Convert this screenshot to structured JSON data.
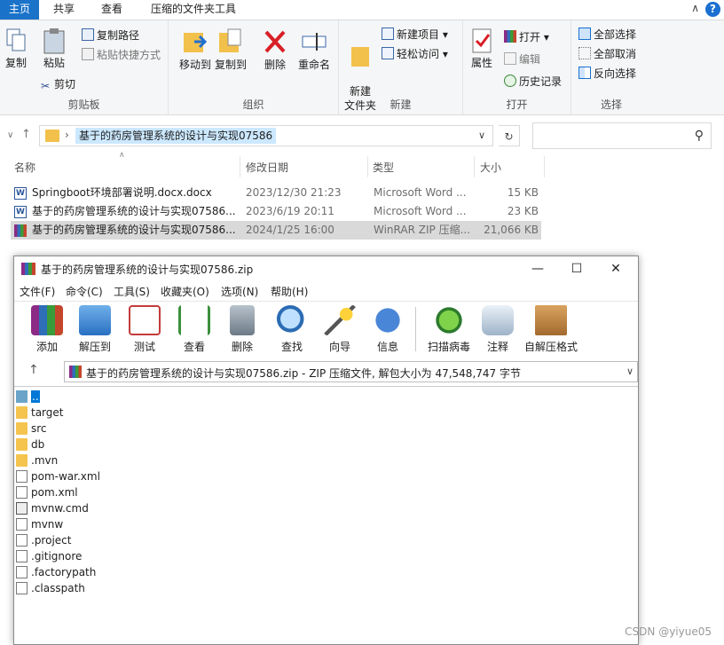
{
  "ribbon": {
    "tabs": [
      "主页",
      "共享",
      "查看",
      "压缩的文件夹工具"
    ],
    "groups": {
      "clipboard": {
        "label": "剪贴板",
        "copy": "复制",
        "paste": "粘贴",
        "copy_path": "复制路径",
        "paste_shortcut": "粘贴快捷方式",
        "cut": "剪切"
      },
      "organize": {
        "label": "组织",
        "move_to": "移动到",
        "copy_to": "复制到",
        "delete": "删除",
        "rename": "重命名"
      },
      "new": {
        "label": "新建",
        "new_folder": "新建\n文件夹",
        "new_item": "新建项目",
        "easy_access": "轻松访问"
      },
      "open": {
        "label": "打开",
        "properties": "属性",
        "open": "打开",
        "edit": "编辑",
        "history": "历史记录"
      },
      "select": {
        "label": "选择",
        "select_all": "全部选择",
        "select_none": "全部取消",
        "invert": "反向选择"
      }
    }
  },
  "address": {
    "path": "基于的药房管理系统的设计与实现07586"
  },
  "columns": {
    "name": "名称",
    "date": "修改日期",
    "type": "类型",
    "size": "大小"
  },
  "files": [
    {
      "name": "Springboot环境部署说明.docx.docx",
      "date": "2023/12/30 21:23",
      "type": "Microsoft Word ...",
      "size": "15 KB"
    },
    {
      "name": "基于的药房管理系统的设计与实现07586...",
      "date": "2023/6/19 20:11",
      "type": "Microsoft Word ...",
      "size": "23 KB"
    },
    {
      "name": "基于的药房管理系统的设计与实现07586...",
      "date": "2024/1/25 16:00",
      "type": "WinRAR ZIP 压缩...",
      "size": "21,066 KB"
    }
  ],
  "winrar": {
    "title": "基于的药房管理系统的设计与实现07586.zip",
    "menus": [
      "文件(F)",
      "命令(C)",
      "工具(S)",
      "收藏夹(O)",
      "选项(N)",
      "帮助(H)"
    ],
    "tools": [
      "添加",
      "解压到",
      "测试",
      "查看",
      "删除",
      "查找",
      "向导",
      "信息",
      "扫描病毒",
      "注释",
      "自解压格式"
    ],
    "path": "基于的药房管理系统的设计与实现07586.zip - ZIP 压缩文件, 解包大小为 47,548,747 字节",
    "entries": [
      "..",
      "target",
      "src",
      "db",
      ".mvn",
      "pom-war.xml",
      "pom.xml",
      "mvnw.cmd",
      "mvnw",
      ".project",
      ".gitignore",
      ".factorypath",
      ".classpath"
    ]
  },
  "watermark": "CSDN @yiyue05",
  "colors": {
    "accent": "#1a73c9",
    "selection": "#cce8ff",
    "winrar_highlight": "#0078d7"
  }
}
